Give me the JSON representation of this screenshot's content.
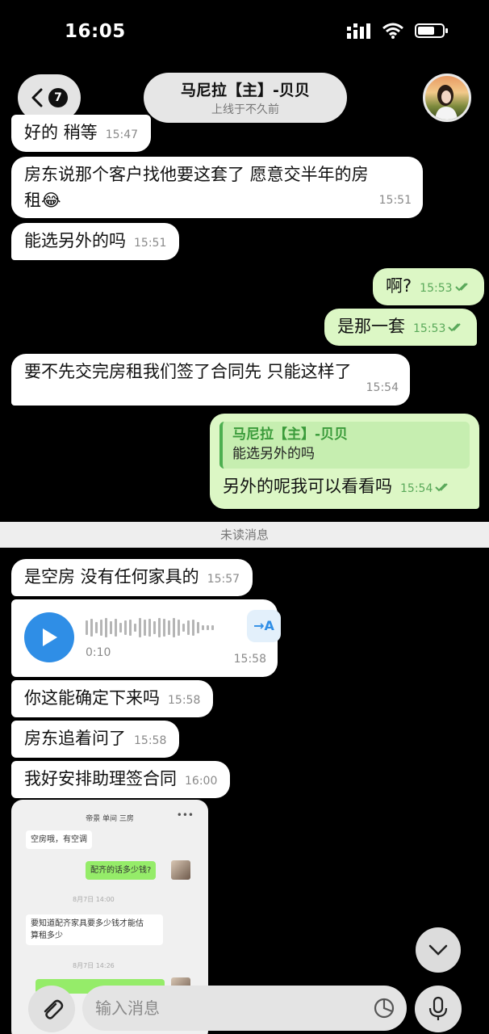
{
  "status_bar": {
    "time": "16:05"
  },
  "header": {
    "back_badge": "7",
    "contact_name": "马尼拉【主】-贝贝",
    "contact_status": "上线于不久前"
  },
  "messages": [
    {
      "text": "好的 稍等",
      "time": "15:47"
    },
    {
      "text": "房东说那个客户找他要这套了 愿意交半年的房",
      "text2": "租😂",
      "time": "15:51"
    },
    {
      "text": "能选另外的吗",
      "time": "15:51"
    },
    {
      "text": "啊?",
      "time": "15:53"
    },
    {
      "text": "是那一套",
      "time": "15:53"
    },
    {
      "text": "要不先交完房租我们签了合同先  只能这样了",
      "time": "15:54"
    },
    {
      "quote_name": "马尼拉【主】-贝贝",
      "quote_text": "能选另外的吗",
      "text": "另外的呢我可以看看吗",
      "time": "15:54"
    },
    {
      "text": "是空房  没有任何家具的",
      "time": "15:57"
    },
    {
      "voice_duration": "0:10",
      "transcribe_label": "→A",
      "time": "15:58"
    },
    {
      "text": "你这能确定下来吗",
      "time": "15:58"
    },
    {
      "text": "房东追着问了",
      "time": "15:58"
    },
    {
      "text": "我好安排助理签合同",
      "time": "16:00"
    }
  ],
  "unread_label": "未读消息",
  "embedded_image": {
    "title": "帝景 单间  三房",
    "msg1": "空房哦，有空调",
    "msg2": "配齐的话多少钱?",
    "date1": "8月7日 14:00",
    "msg3": "要知道配齐家具要多少钱才能估",
    "msg3b": "算租多少",
    "date2": "8月7日 14:26"
  },
  "composer": {
    "placeholder": "输入消息"
  }
}
